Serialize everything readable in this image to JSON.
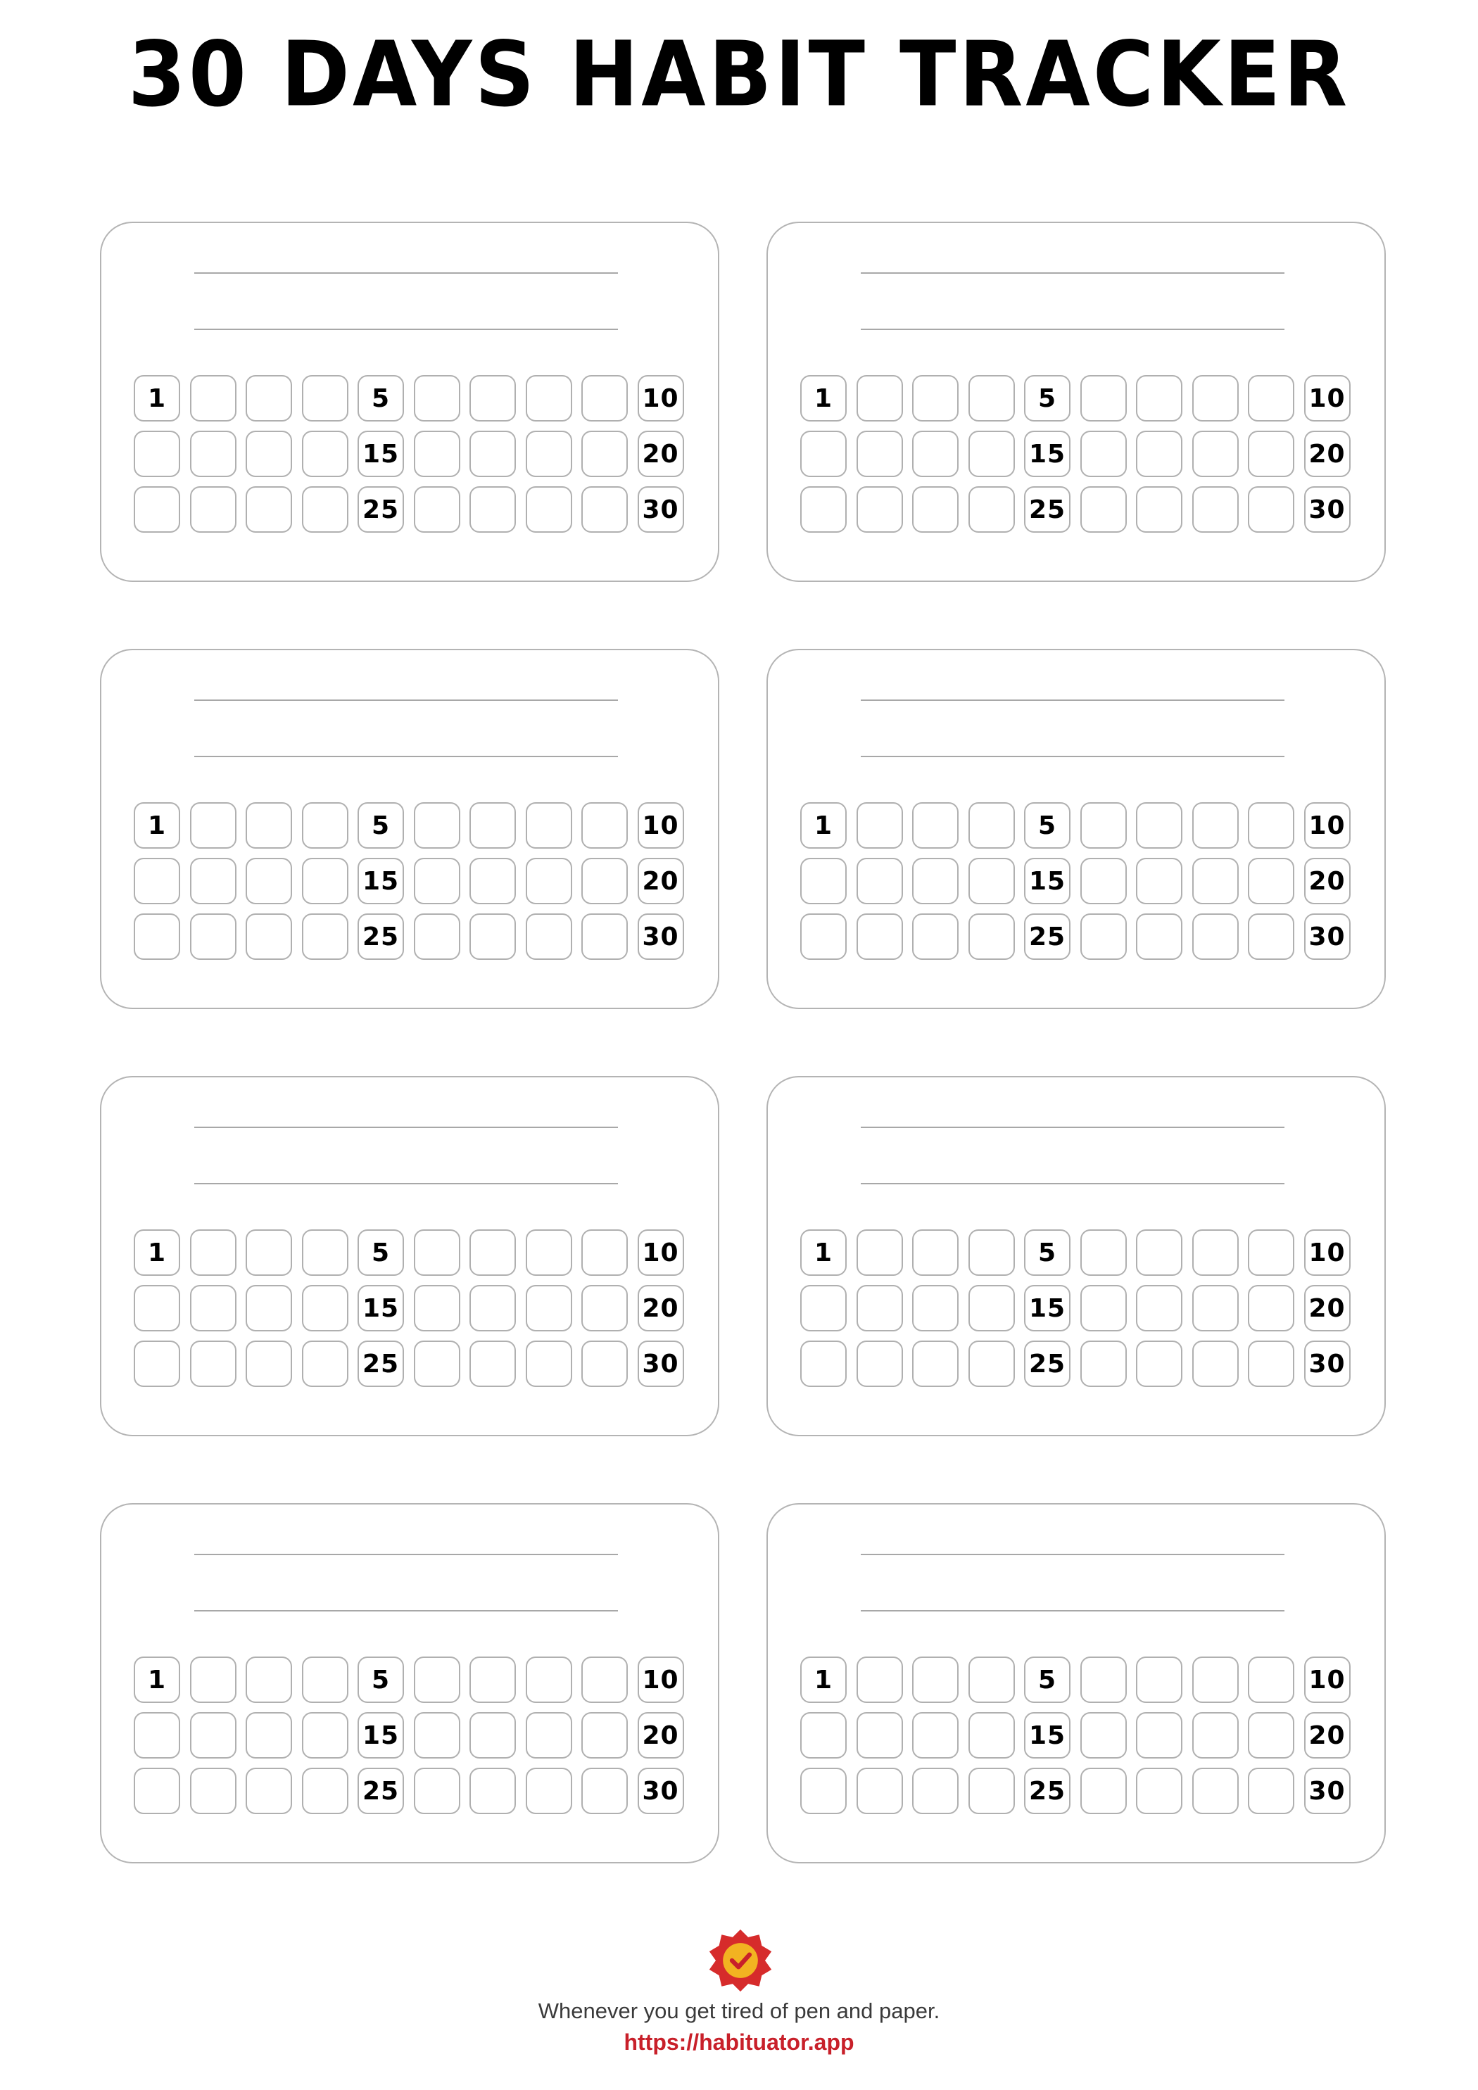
{
  "page": {
    "title": "30 DAYS HABIT TRACKER"
  },
  "tracker": {
    "card_count": 8,
    "days_per_row": 10,
    "rows": 3,
    "labeled_days": [
      "1",
      "5",
      "10",
      "15",
      "20",
      "25",
      "30"
    ],
    "title_lines_per_card": 2
  },
  "footer": {
    "logo_icon": "checkmark-badge-icon",
    "tagline": "Whenever you get tired of pen and paper.",
    "url": "https://habituator.app",
    "colors": {
      "badge": "#d62b2b",
      "check_circle": "#f2b321",
      "url_text": "#c8202a"
    }
  }
}
